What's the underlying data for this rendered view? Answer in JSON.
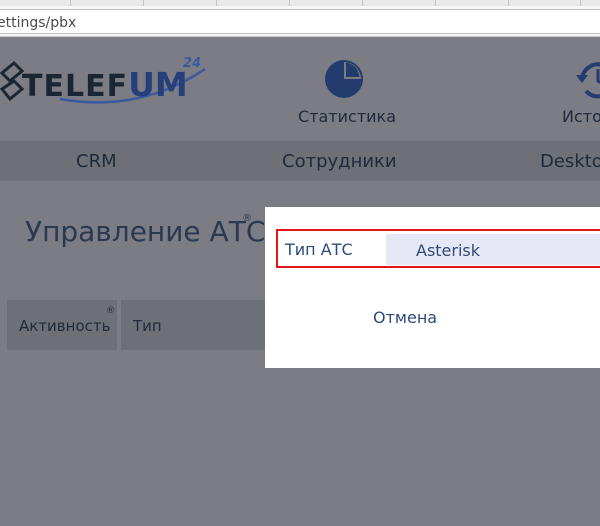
{
  "browser": {
    "url_text": "ettings/pbx"
  },
  "header": {
    "logo": {
      "text_a": "TELEF",
      "text_b": "UM",
      "superscript": "24"
    },
    "nav": [
      {
        "label": "Статистика",
        "icon": "pie-chart-icon"
      },
      {
        "label": "Исто",
        "icon": "history-icon"
      }
    ]
  },
  "menu": {
    "items": [
      "CRM",
      "Сотрудники",
      "Deskto"
    ]
  },
  "page": {
    "title": "Управление АТС",
    "title_mark": "®",
    "table": {
      "headers": [
        "Активность",
        "Тип"
      ],
      "header_mark": "®"
    }
  },
  "modal": {
    "field_label": "Тип АТС",
    "select_value": "Asterisk",
    "cancel_label": "Отмена"
  },
  "colors": {
    "overlay_bg": "#7b7c84",
    "accent_red": "#e2141c",
    "text_blue": "#2e4a7a",
    "select_bg": "#e6e8f6"
  }
}
